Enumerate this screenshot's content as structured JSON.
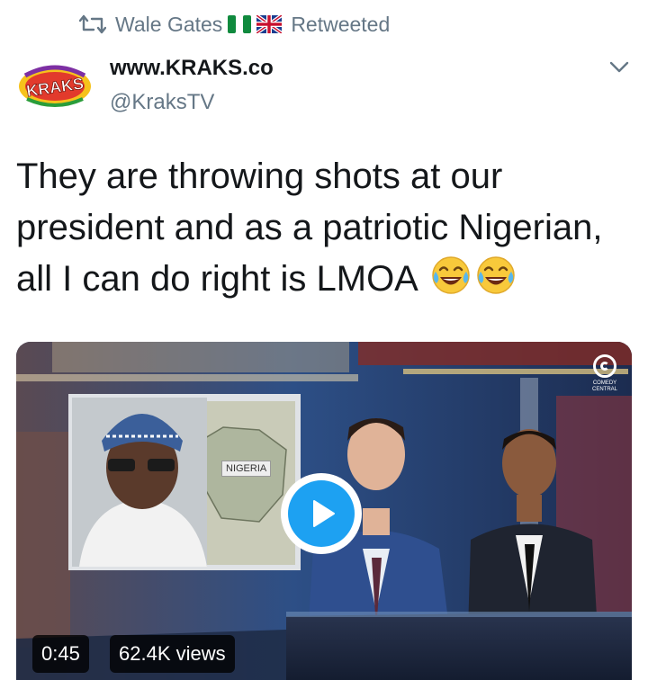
{
  "retweet": {
    "icon": "retweet-icon",
    "user": "Wale Gates",
    "flags": [
      "nigeria-flag",
      "uk-flag"
    ],
    "label": "Retweeted"
  },
  "author": {
    "avatar": "kraks-logo",
    "avatar_text": "KRAKS",
    "name": "www.KRAKS.co",
    "handle": "@KraksTV"
  },
  "menu": {
    "icon": "chevron-down-icon"
  },
  "tweet": {
    "lines": [
      "They are throwing shots at our",
      "president and as a patriotic Nigerian,",
      "all I can do right is LMOA"
    ],
    "emoji": [
      "face-with-tears-of-joy-emoji",
      "face-with-tears-of-joy-emoji"
    ]
  },
  "video": {
    "duration": "0:45",
    "views": "62.4K views",
    "map_label": "NIGERIA",
    "channel_logo": "comedy-central-logo",
    "channel_text": "COMEDY CENTRAL",
    "play_icon": "play-icon",
    "colors": {
      "play": "#1da1f2"
    }
  },
  "colors": {
    "text": "#14171a",
    "muted": "#657786",
    "accent": "#1da1f2"
  }
}
